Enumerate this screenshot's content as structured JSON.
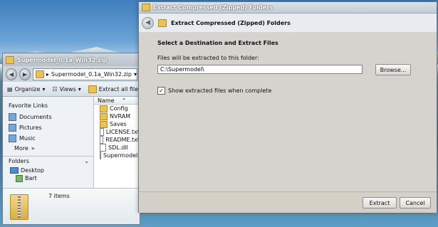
{
  "explorer": {
    "title": "Supermodel_0.1a_Win32.zip",
    "address": "Supermodel_0.1a_Win32.zip",
    "toolbar": {
      "organize": "Organize",
      "views": "Views",
      "extract_all": "Extract all files"
    },
    "favorites_header": "Favorite Links",
    "favorites": [
      "Documents",
      "Pictures",
      "Music",
      "More"
    ],
    "folders_header": "Folders",
    "tree": [
      "Desktop",
      "Bart"
    ],
    "column_name": "Name",
    "files": [
      {
        "name": "Config",
        "type": "folder"
      },
      {
        "name": "NVRAM",
        "type": "folder"
      },
      {
        "name": "Saves",
        "type": "folder"
      },
      {
        "name": "LICENSE.txt",
        "type": "doc"
      },
      {
        "name": "README.txt",
        "type": "doc"
      },
      {
        "name": "SDL.dll",
        "type": "doc"
      },
      {
        "name": "Supermodel.e",
        "type": "doc"
      }
    ],
    "status": "7 items"
  },
  "dialog": {
    "title": "Extract Compressed (Zipped) Folders",
    "header": "Extract Compressed (Zipped) Folders",
    "section_title": "Select a Destination and Extract Files",
    "field_label": "Files will be extracted to this folder:",
    "path_value": "C:\\Supermodel\\",
    "browse_label": "Browse...",
    "checkbox_label": "Show extracted files when complete",
    "checkbox_checked": true,
    "extract_label": "Extract",
    "cancel_label": "Cancel"
  }
}
